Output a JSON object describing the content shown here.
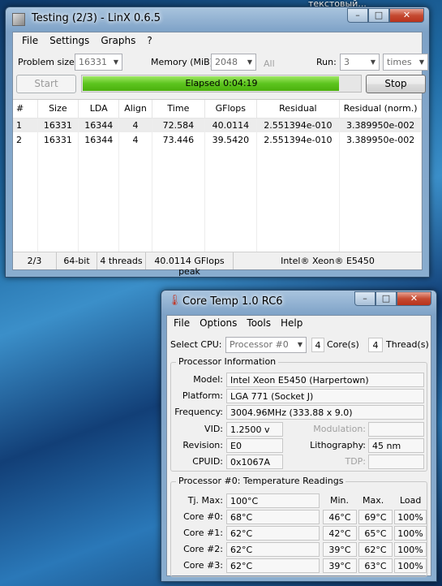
{
  "desktop": {
    "label": "текстовый..."
  },
  "linx": {
    "title": "Testing (2/3) - LinX 0.6.5",
    "menu": [
      "File",
      "Settings",
      "Graphs",
      "?"
    ],
    "problem_size_label": "Problem size:",
    "problem_size_value": "16331",
    "memory_label": "Memory (MiB):",
    "memory_value": "2048",
    "all_label": "All",
    "run_label": "Run:",
    "run_value": "3",
    "run_unit": "times",
    "start_label": "Start",
    "stop_label": "Stop",
    "progress_text": "Elapsed 0:04:19",
    "progress_fraction": 0.92,
    "columns": [
      "#",
      "Size",
      "LDA",
      "Align",
      "Time",
      "GFlops",
      "Residual",
      "Residual (norm.)"
    ],
    "rows": [
      [
        "1",
        "16331",
        "16344",
        "4",
        "72.584",
        "40.0114",
        "2.551394e-010",
        "3.389950e-002"
      ],
      [
        "2",
        "16331",
        "16344",
        "4",
        "73.446",
        "39.5420",
        "2.551394e-010",
        "3.389950e-002"
      ]
    ],
    "status": [
      "2/3",
      "64-bit",
      "4 threads",
      "40.0114 GFlops peak",
      "Intel® Xeon® E5450"
    ]
  },
  "coretemp": {
    "title": "Core Temp 1.0 RC6",
    "menu": [
      "File",
      "Options",
      "Tools",
      "Help"
    ],
    "select_cpu_label": "Select CPU:",
    "select_cpu_value": "Processor #0",
    "cores_value": "4",
    "cores_label": "Core(s)",
    "threads_value": "4",
    "threads_label": "Thread(s)",
    "info_title": "Processor Information",
    "model_label": "Model:",
    "model_value": "Intel Xeon E5450 (Harpertown)",
    "platform_label": "Platform:",
    "platform_value": "LGA 771 (Socket J)",
    "frequency_label": "Frequency:",
    "frequency_value": "3004.96MHz (333.88 x 9.0)",
    "vid_label": "VID:",
    "vid_value": "1.2500 v",
    "modulation_label": "Modulation:",
    "revision_label": "Revision:",
    "revision_value": "E0",
    "lithography_label": "Lithography:",
    "lithography_value": "45 nm",
    "cpuid_label": "CPUID:",
    "cpuid_value": "0x1067A",
    "tdp_label": "TDP:",
    "temp_title": "Processor #0: Temperature Readings",
    "tjmax_label": "Tj. Max:",
    "tjmax_value": "100°C",
    "col_min": "Min.",
    "col_max": "Max.",
    "col_load": "Load",
    "cores": [
      {
        "label": "Core #0:",
        "temp": "68°C",
        "min": "46°C",
        "max": "69°C",
        "load": "100%"
      },
      {
        "label": "Core #1:",
        "temp": "62°C",
        "min": "42°C",
        "max": "65°C",
        "load": "100%"
      },
      {
        "label": "Core #2:",
        "temp": "62°C",
        "min": "39°C",
        "max": "62°C",
        "load": "100%"
      },
      {
        "label": "Core #3:",
        "temp": "62°C",
        "min": "39°C",
        "max": "63°C",
        "load": "100%"
      }
    ]
  }
}
